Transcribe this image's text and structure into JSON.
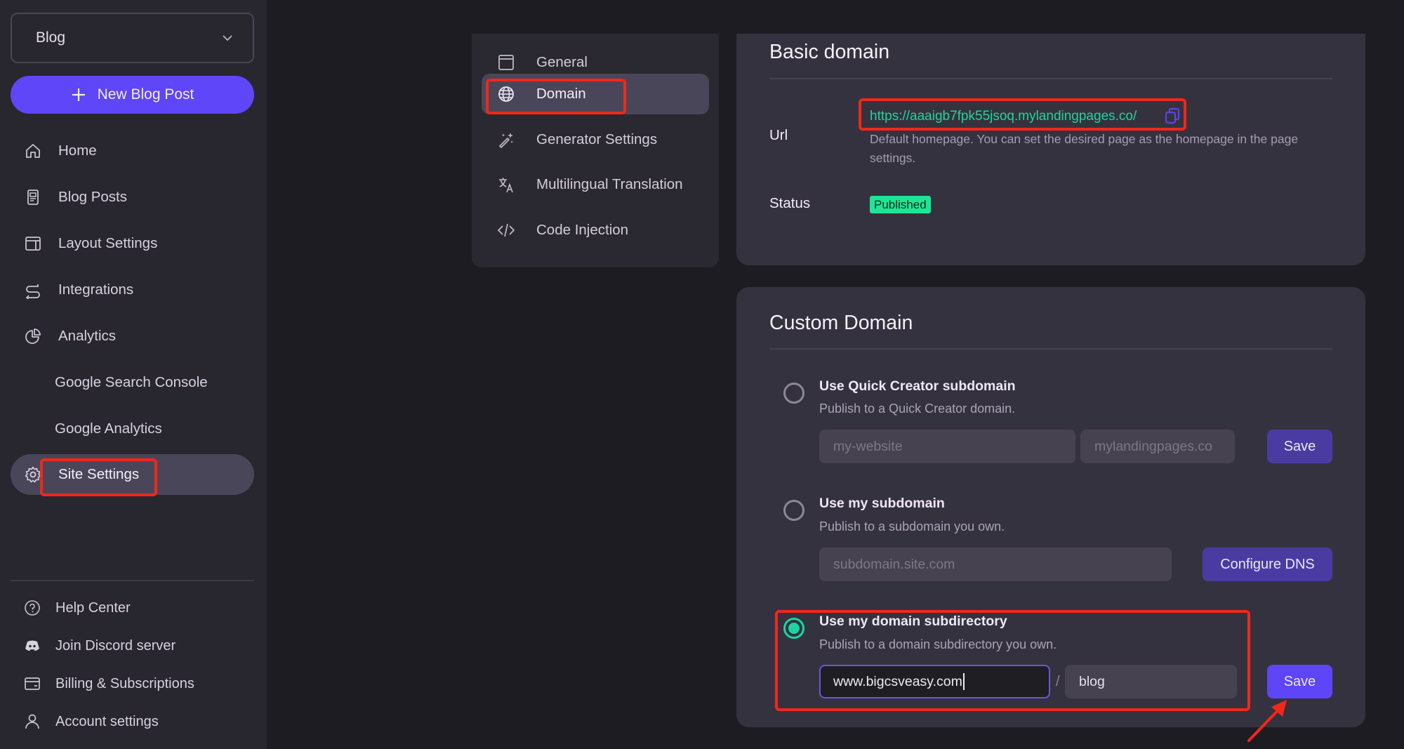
{
  "sidebar": {
    "site_selector": {
      "value": "Blog"
    },
    "new_post_label": "New Blog Post",
    "nav": [
      {
        "label": "Home",
        "icon": "home-icon"
      },
      {
        "label": "Blog Posts",
        "icon": "document-icon"
      },
      {
        "label": "Layout Settings",
        "icon": "layout-icon"
      },
      {
        "label": "Integrations",
        "icon": "integrations-icon"
      },
      {
        "label": "Analytics",
        "icon": "pie-chart-icon"
      },
      {
        "label": "Google Search Console"
      },
      {
        "label": "Google Analytics"
      },
      {
        "label": "Site Settings",
        "icon": "gear-icon",
        "active": true
      }
    ],
    "footer": [
      {
        "label": "Help Center",
        "icon": "help-circle-icon"
      },
      {
        "label": "Join Discord server",
        "icon": "discord-icon"
      },
      {
        "label": "Billing & Subscriptions",
        "icon": "credit-card-icon"
      },
      {
        "label": "Account settings",
        "icon": "user-icon"
      }
    ]
  },
  "settings_nav": [
    {
      "label": "General",
      "icon": "window-icon"
    },
    {
      "label": "Domain",
      "icon": "globe-icon",
      "active": true
    },
    {
      "label": "Generator Settings",
      "icon": "magic-wand-icon"
    },
    {
      "label": "Multilingual Translation",
      "icon": "translate-icon"
    },
    {
      "label": "Code Injection",
      "icon": "code-icon"
    }
  ],
  "basic_domain": {
    "title": "Basic domain",
    "url_label": "Url",
    "url": "https://aaaigb7fpk55jsoq.mylandingpages.co/",
    "url_help": "Default homepage. You can set the desired page as the homepage in the page settings.",
    "status_label": "Status",
    "status": "Published"
  },
  "custom_domain": {
    "title": "Custom Domain",
    "options": [
      {
        "title": "Use Quick Creator subdomain",
        "description": "Publish to a Quick Creator domain.",
        "selected": false,
        "subdomain_placeholder": "my-website",
        "domain_suffix": "mylandingpages.co",
        "button": "Save"
      },
      {
        "title": "Use my subdomain",
        "description": "Publish to a subdomain you own.",
        "selected": false,
        "subdomain_placeholder": "subdomain.site.com",
        "button": "Configure DNS"
      },
      {
        "title": "Use my domain subdirectory",
        "description": "Publish to a domain subdirectory you own.",
        "selected": true,
        "domain_value": "www.bigcsveasy.com",
        "separator": "/",
        "path_value": "blog",
        "button": "Save"
      }
    ]
  },
  "colors": {
    "accent": "#5f46f8",
    "button_secondary": "#4a3ba3",
    "success": "#1ee594",
    "link": "#1fd59b",
    "annotation": "#f0281a"
  }
}
